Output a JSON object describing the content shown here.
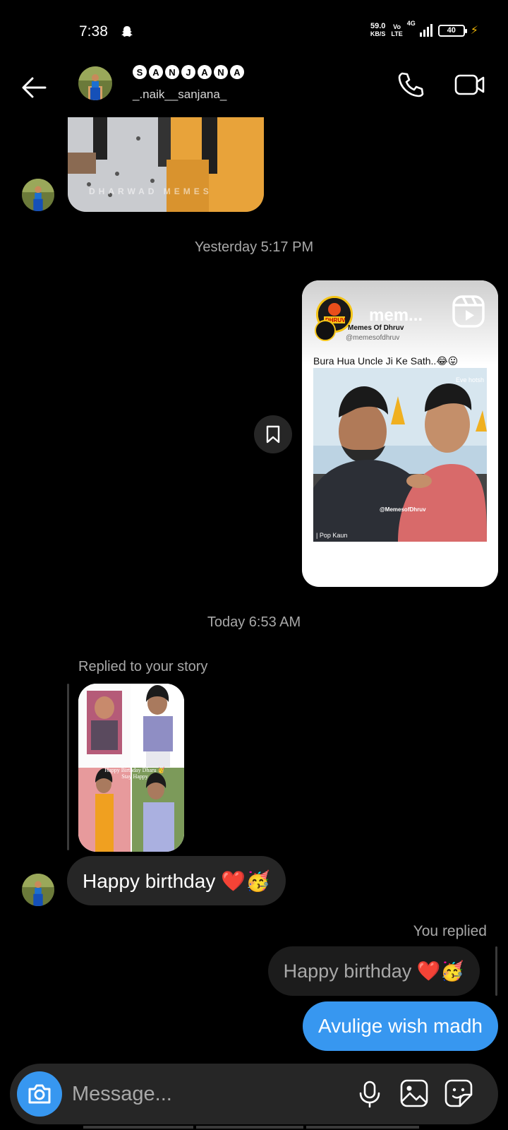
{
  "status_bar": {
    "time": "7:38",
    "speed_value": "59.0",
    "speed_unit": "KB/S",
    "volte_top": "Vo",
    "volte_bottom": "LTE",
    "network": "4G",
    "battery": "40"
  },
  "header": {
    "name_letters": [
      "S",
      "A",
      "N",
      "J",
      "A",
      "N",
      "A"
    ],
    "handle": "_.naik__sanjana_"
  },
  "image_message": {
    "watermark": "DHARWAD MEMES"
  },
  "timestamps": {
    "yesterday": "Yesterday 5:17 PM",
    "today": "Today 6:53 AM"
  },
  "reel": {
    "title": "mem...",
    "account_name": "Memes Of Dhruv",
    "account_handle": "@memesofdhruv",
    "logo_text": "DHRUV",
    "caption": "Bura Hua Uncle Ji Ke Sath..",
    "caption_emojis": "😂😛",
    "video_watermark": "@MemesofDhruv",
    "video_label": "| Pop Kaun",
    "video_corner_text": "Eve hotsh"
  },
  "story_reply": {
    "label": "Replied to your story",
    "overlay_text": "Happy Birthday Dharu 🥳 Stay Happy"
  },
  "messages": {
    "incoming": "Happy birthday ❤️🥳",
    "you_replied_label": "You replied",
    "quoted": "Happy birthday ❤️🥳",
    "outgoing": "Avulige wish madh"
  },
  "composer": {
    "placeholder": "Message..."
  },
  "colors": {
    "accent_blue": "#3797f0",
    "bubble_gray": "#262626",
    "secondary_text": "#a8a8a8",
    "battery_bolt": "#f2b705"
  }
}
